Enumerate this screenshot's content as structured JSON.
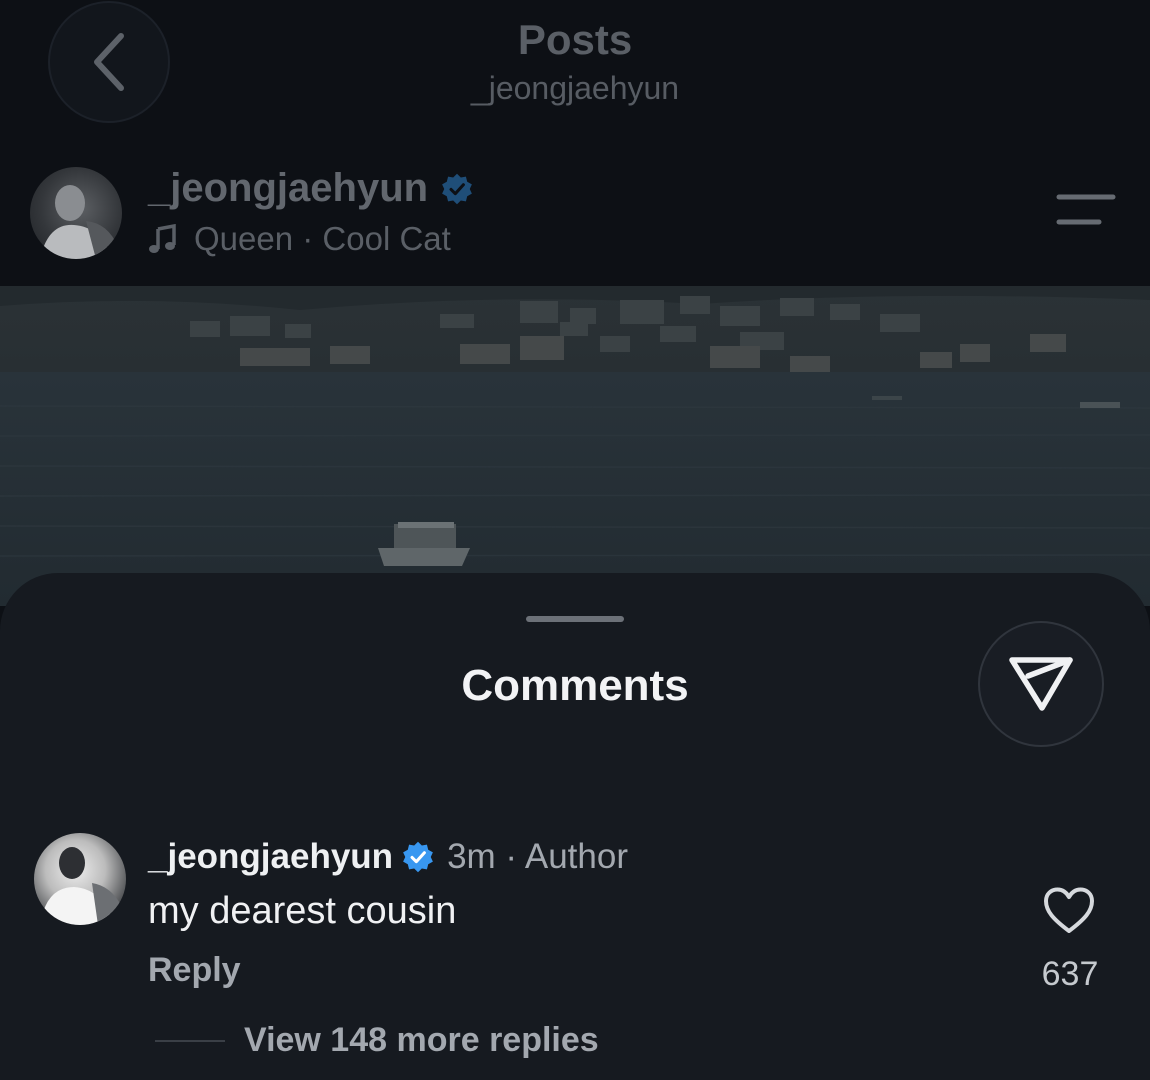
{
  "nav": {
    "back_icon": "chevron-left-icon",
    "title": "Posts",
    "subtitle": "_jeongjaehyun"
  },
  "post": {
    "username": "_jeongjaehyun",
    "verified": true,
    "music_icon": "music-note-icon",
    "music": "Queen · Cool Cat",
    "menu_icon": "menu-icon"
  },
  "comments_sheet": {
    "title": "Comments",
    "share_icon": "send-icon",
    "comment": {
      "username": "_jeongjaehyun",
      "verified": true,
      "meta": "3m · Author",
      "text": "my dearest cousin",
      "reply_label": "Reply",
      "like_icon": "heart-icon",
      "like_count": "637",
      "view_replies": "View 148 more replies"
    }
  },
  "colors": {
    "background": "#0d1015",
    "sheet": "#161a20",
    "verified_blue": "#3897f0"
  }
}
